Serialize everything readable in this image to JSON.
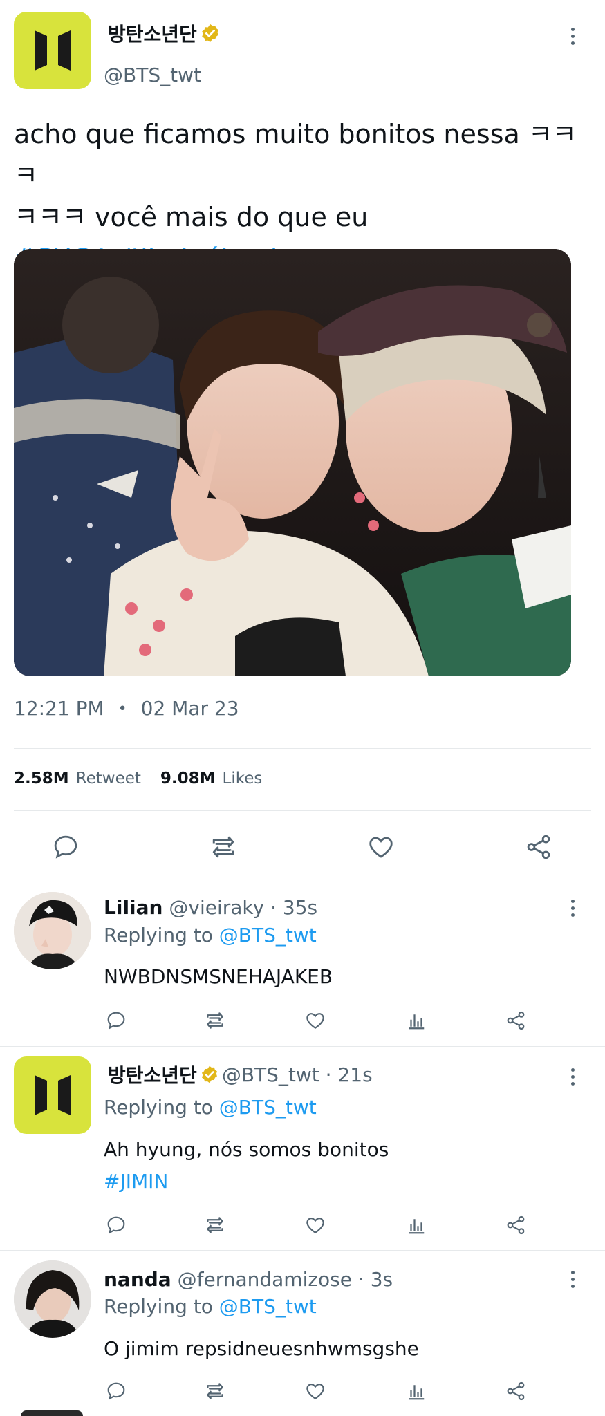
{
  "tweet": {
    "display_name": "방탄소년단",
    "handle": "@BTS_twt",
    "text_line1": "acho que ficamos muito bonitos nessa ㅋㅋㅋ",
    "text_line2": "ㅋㅋㅋ você mais do que eu",
    "hashtags": "#SUGA #jiminébonito",
    "time": "12:21 PM",
    "date": "02 Mar 23",
    "separator": "•",
    "retweets_count": "2.58M",
    "retweets_label": "Retweet",
    "likes_count": "9.08M",
    "likes_label": "Likes",
    "photo_alt": "selfie photo"
  },
  "replies": [
    {
      "name": "Lilian",
      "meta": "@vieiraky · 35s",
      "replying_prefix": "Replying to",
      "replying_handle": "@BTS_twt",
      "text": "NWBDNSMSNEHAJAKEB",
      "hashtag": ""
    },
    {
      "name": "방탄소년단",
      "meta": "@BTS_twt · 21s",
      "replying_prefix": "Replying to",
      "replying_handle": "@BTS_twt",
      "text": "Ah hyung, nós somos bonitos",
      "hashtag": "#JIMIN"
    },
    {
      "name": "nanda",
      "meta": "@fernandamizose · 3s",
      "replying_prefix": "Replying to",
      "replying_handle": "@BTS_twt",
      "text": "O jimim repsidneuesnhwmsgshe",
      "hashtag": ""
    }
  ],
  "icons": {
    "reply": "comment-icon",
    "retweet": "retweet-icon",
    "like": "heart-icon",
    "views": "analytics-icon",
    "share": "share-icon",
    "more": "more-vertical-icon",
    "verified": "verified-badge-icon"
  },
  "colors": {
    "accent": "#1d9bf0",
    "logo_bg": "#d8e33c",
    "verified": "#e2b719",
    "muted": "#536471"
  }
}
